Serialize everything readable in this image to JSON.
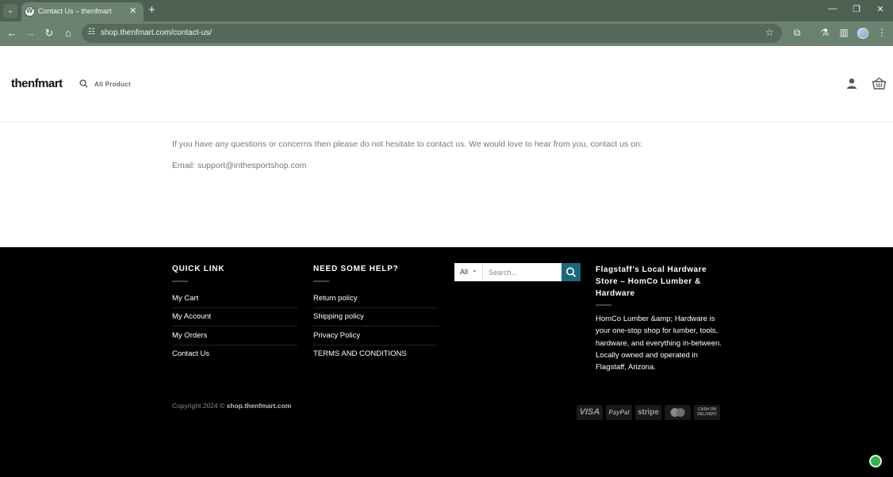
{
  "browser": {
    "tab_title": "Contact Us – thenfmart",
    "url": "shop.thenfmart.com/contact-us/"
  },
  "header": {
    "logo": "thenfmart",
    "all_product": "All Product"
  },
  "main": {
    "contact_text": "If you have any questions or concerns then please do not hesitate to contact us. We would love to hear from you, contact us on:",
    "email_text": "Email: support@inthesportshop.com"
  },
  "footer": {
    "quick_link": {
      "heading": "QUICK LINK",
      "items": [
        "My Cart",
        "My Account",
        "My Orders",
        "Contact Us"
      ]
    },
    "help": {
      "heading": "NEED SOME HELP?",
      "items": [
        "Return policy",
        "Shipping policy",
        "Privacy Policy",
        "TERMS AND CONDITIONS"
      ]
    },
    "search": {
      "category": "All",
      "placeholder": "Search..."
    },
    "about": {
      "heading": "Flagstaff’s Local Hardware Store – HomCo Lumber & Hardware",
      "text": "HomCo Lumber &amp; Hardware is your one-stop shop for lumber, tools, hardware, and everything in-between. Locally owned and operated in Flagstaff, Arizona."
    },
    "copyright_prefix": "Copyright 2024 ©",
    "copyright_site": "shop.thenfmart.com",
    "payments": [
      "VISA",
      "PayPal",
      "stripe",
      "mastercard",
      "CASH ON DELIVERY"
    ]
  }
}
